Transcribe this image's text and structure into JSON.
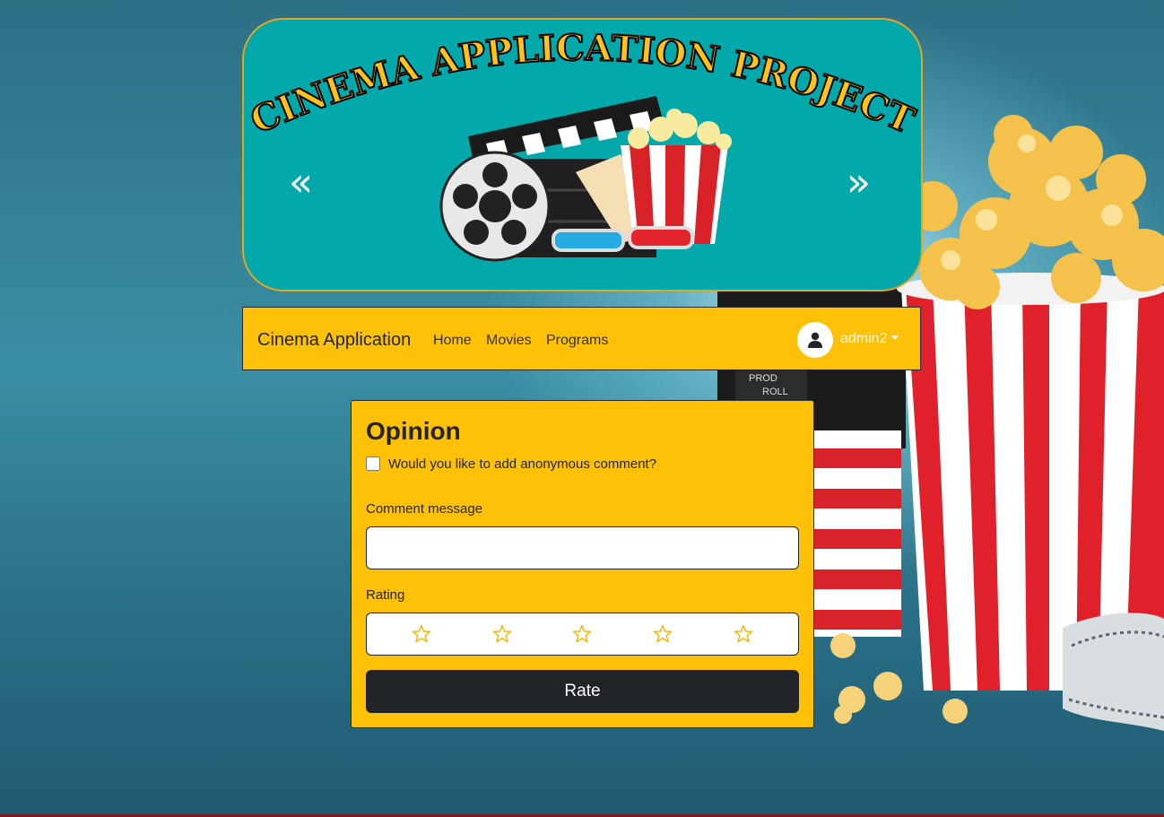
{
  "banner": {
    "title_art": "Cinema Application Project",
    "prev_glyph": "«",
    "next_glyph": "»",
    "bg_color": "#03a8ab",
    "border_color": "#e8a51b"
  },
  "navbar": {
    "brand": "Cinema Application",
    "links": [
      "Home",
      "Movies",
      "Programs"
    ],
    "user": "admin2",
    "avatar_icon": "user-icon",
    "bg_color": "#fec107"
  },
  "opinion": {
    "title": "Opinion",
    "anonymous_label": "Would you like to add anonymous comment?",
    "anonymous_checked": false,
    "comment_label": "Comment message",
    "comment_value": "",
    "rating_label": "Rating",
    "rating_value": 0,
    "rating_max": 5,
    "star_icon": "star-outline-icon",
    "button_label": "Rate",
    "button_color": "#212529"
  }
}
